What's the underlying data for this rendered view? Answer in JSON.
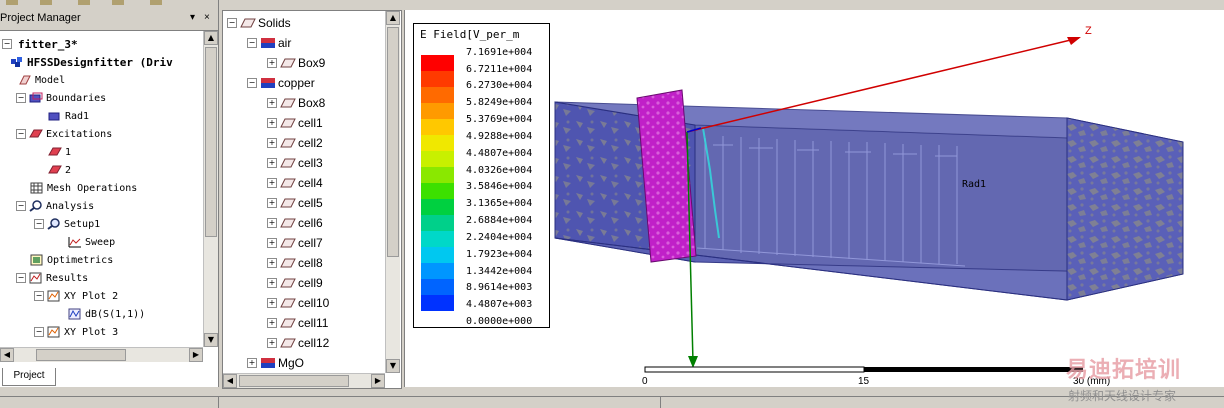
{
  "project_manager": {
    "title": "Project Manager",
    "pin": "▾",
    "close": "×",
    "tab_label": "Project",
    "items": [
      {
        "label": "fitter_3*",
        "icon": "project-icon"
      },
      {
        "label": "HFSSDesignfitter (Driv",
        "icon": "hfss-design-icon"
      },
      {
        "label": "Model",
        "icon": "model-icon"
      },
      {
        "label": "Boundaries",
        "icon": "boundaries-icon"
      },
      {
        "label": "Rad1",
        "icon": "radiation-boundary-icon"
      },
      {
        "label": "Excitations",
        "icon": "excitations-icon"
      },
      {
        "label": "1",
        "icon": "port-icon"
      },
      {
        "label": "2",
        "icon": "port-icon"
      },
      {
        "label": "Mesh Operations",
        "icon": "mesh-icon"
      },
      {
        "label": "Analysis",
        "icon": "analysis-icon"
      },
      {
        "label": "Setup1",
        "icon": "setup-icon"
      },
      {
        "label": "Sweep",
        "icon": "sweep-icon"
      },
      {
        "label": "Optimetrics",
        "icon": "optimetrics-icon"
      },
      {
        "label": "Results",
        "icon": "results-icon"
      },
      {
        "label": "XY Plot 2",
        "icon": "xy-plot-icon"
      },
      {
        "label": "dB(S(1,1))",
        "icon": "trace-icon"
      },
      {
        "label": "XY Plot 3",
        "icon": "xy-plot-icon"
      }
    ]
  },
  "history_tree": {
    "items": [
      {
        "label": "Solids",
        "expander": "−"
      },
      {
        "label": "air",
        "expander": "−"
      },
      {
        "label": "Box9",
        "expander": "+"
      },
      {
        "label": "copper",
        "expander": "−"
      },
      {
        "label": "Box8",
        "expander": "+"
      },
      {
        "label": "cell1",
        "expander": "+"
      },
      {
        "label": "cell2",
        "expander": "+"
      },
      {
        "label": "cell3",
        "expander": "+"
      },
      {
        "label": "cell4",
        "expander": "+"
      },
      {
        "label": "cell5",
        "expander": "+"
      },
      {
        "label": "cell6",
        "expander": "+"
      },
      {
        "label": "cell7",
        "expander": "+"
      },
      {
        "label": "cell8",
        "expander": "+"
      },
      {
        "label": "cell9",
        "expander": "+"
      },
      {
        "label": "cell10",
        "expander": "+"
      },
      {
        "label": "cell11",
        "expander": "+"
      },
      {
        "label": "cell12",
        "expander": "+"
      },
      {
        "label": "MgO",
        "expander": "+"
      }
    ]
  },
  "field_legend": {
    "title": "E Field[V_per_m",
    "values": [
      "7.1691e+004",
      "6.7211e+004",
      "6.2730e+004",
      "5.8249e+004",
      "5.3769e+004",
      "4.9288e+004",
      "4.4807e+004",
      "4.0326e+004",
      "3.5846e+004",
      "3.1365e+004",
      "2.6884e+004",
      "2.2404e+004",
      "1.7923e+004",
      "1.3442e+004",
      "8.9614e+003",
      "4.4807e+003",
      "0.0000e+000"
    ],
    "colors": [
      "#ff0000",
      "#ff3a00",
      "#ff6a00",
      "#ff9a00",
      "#ffc800",
      "#f0e800",
      "#c8f000",
      "#8ae800",
      "#3ce000",
      "#00d040",
      "#00d08a",
      "#00d8c8",
      "#00c8f0",
      "#0096ff",
      "#0064ff",
      "#0032ff",
      "#0000ff"
    ]
  },
  "viewport": {
    "axis_label": "Z",
    "boundary_label": "Rad1",
    "scale_ticks": [
      "0",
      "15",
      "30 (mm)"
    ]
  },
  "watermark": {
    "main": "易迪拓培训",
    "sub": "射频和天线设计专家"
  }
}
